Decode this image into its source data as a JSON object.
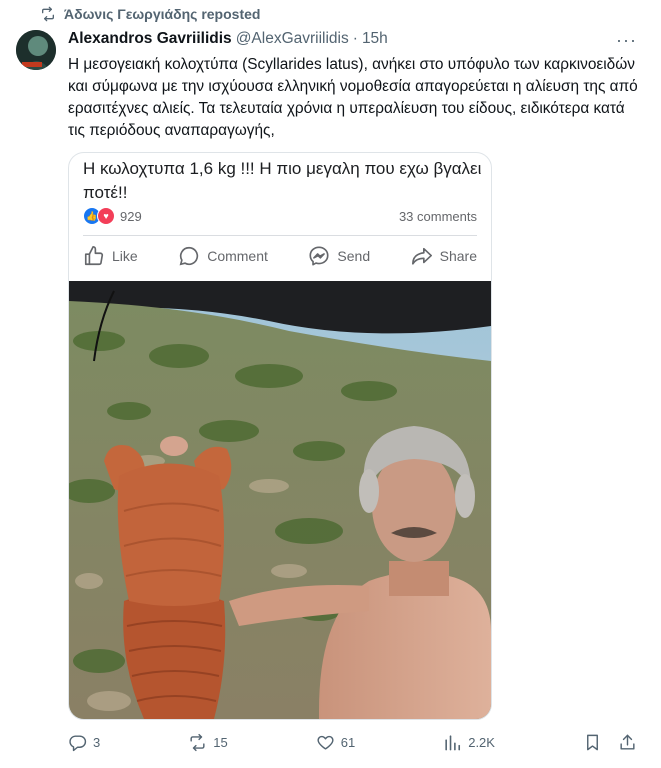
{
  "repost": {
    "text": "Άδωνις Γεωργιάδης reposted",
    "icon": "repost-icon"
  },
  "post": {
    "author_name": "Alexandros Gavriilidis",
    "handle": "@AlexGavriilidis",
    "separator": "·",
    "time": "15h",
    "more_label": "···",
    "text": "Η μεσογειακή κολοχτύπα (Scyllarides latus), ανήκει στο υπόφυλο των καρκινοειδών και σύμφωνα με την ισχύουσα ελληνική νομοθεσία απαγορεύεται η αλίευση της από ερασιτέχνες αλιείς. Τα τελευταία χρόνια η υπεραλίευση του είδους, ειδικότερα κατά τις περιόδους αναπαραγωγής,"
  },
  "embedded_post": {
    "text": "Η κωλοχτυπα 1,6 kg !!! Η πιο μεγαλη που εχω βγαλει ποτέ!!",
    "reactions_count": "929",
    "comments_label": "33 comments",
    "actions": {
      "like": "Like",
      "comment": "Comment",
      "send": "Send",
      "share": "Share"
    }
  },
  "actions": {
    "replies": "3",
    "reposts": "15",
    "likes": "61",
    "views": "2.2K"
  },
  "colors": {
    "accent": "#1d9bf0",
    "text_secondary": "#536471",
    "fb_blue": "#1877f2",
    "fb_red": "#f33e58"
  }
}
